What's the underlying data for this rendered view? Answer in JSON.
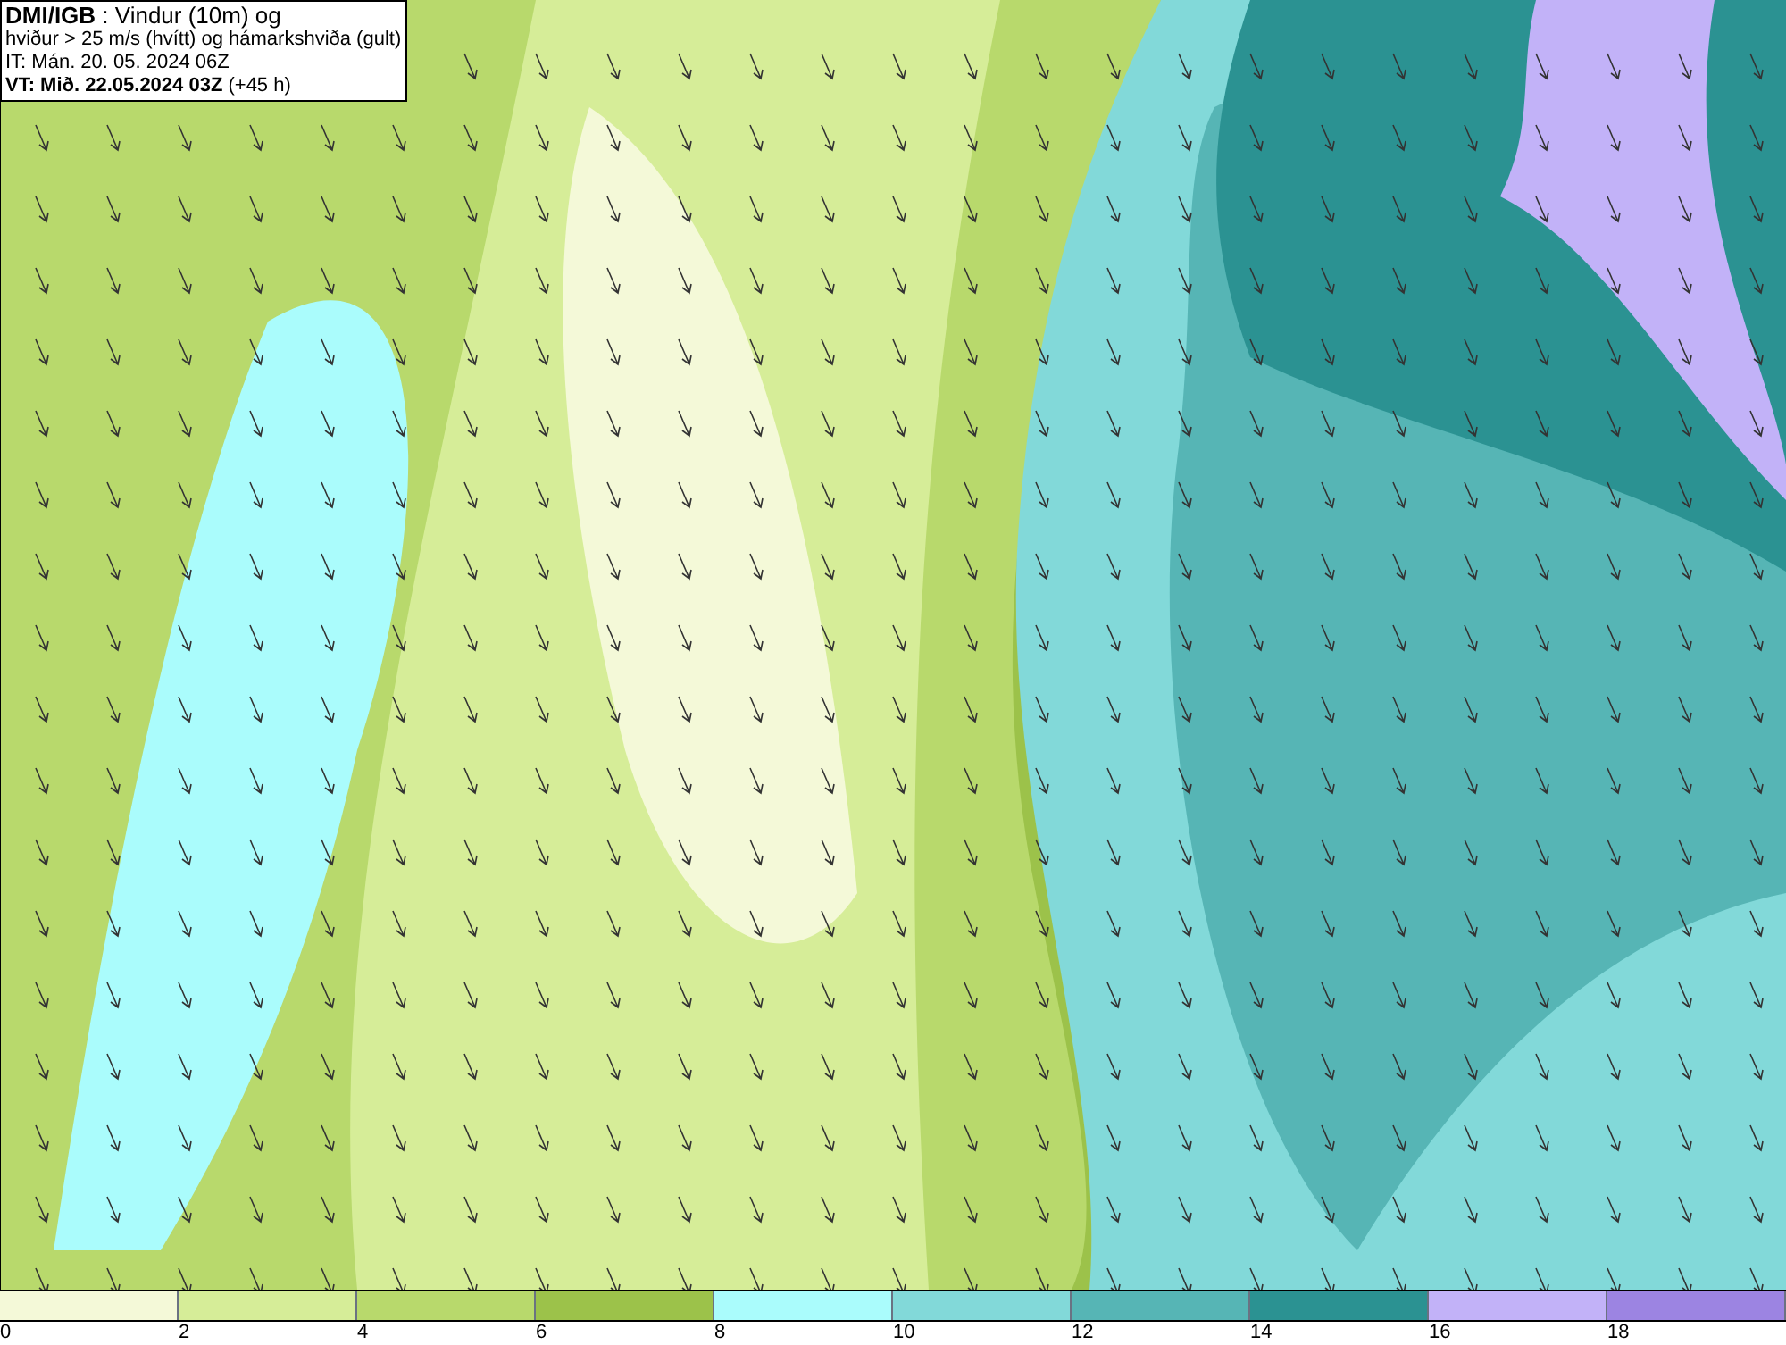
{
  "title_box": {
    "lines": [
      "**DMI/IGB** : Vindur (10m) og",
      "hviður > 25 m/s (hvítt) og hámarkshviða (gult)",
      "IT: Mán. 20. 05. 2024 06Z",
      "**VT: Mið. 22.05.2024 03Z** (+45 h)"
    ]
  },
  "legend": [
    {
      "label": "0",
      "color": "#f4f9d8"
    },
    {
      "label": "2",
      "color": "#d6ed98"
    },
    {
      "label": "4",
      "color": "#b8d96c"
    },
    {
      "label": "6",
      "color": "#9cc24a"
    },
    {
      "label": "8",
      "color": "#aafcfc"
    },
    {
      "label": "10",
      "color": "#82d9d9"
    },
    {
      "label": "12",
      "color": "#56b5b5"
    },
    {
      "label": "14",
      "color": "#2b9292"
    },
    {
      "label": "16",
      "color": "#c2b2f8"
    },
    {
      "label": "18",
      "color": "#9c84e2"
    }
  ]
}
